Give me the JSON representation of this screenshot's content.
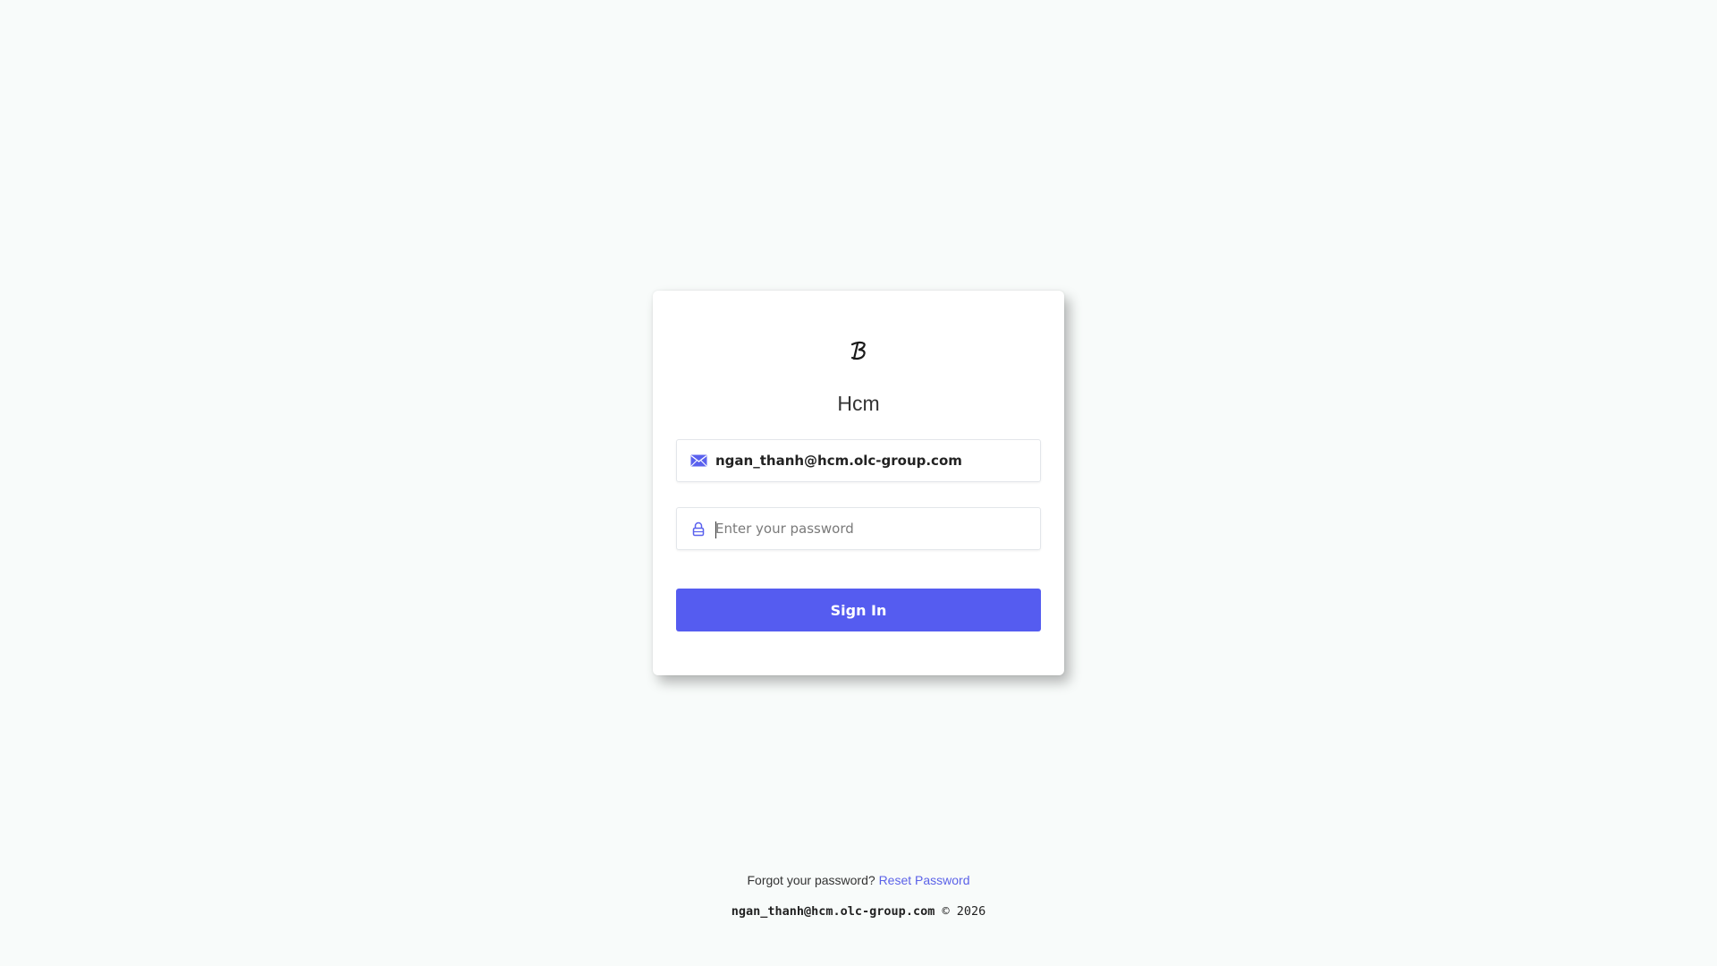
{
  "brand": {
    "logo_icon": "brand-script-b-icon",
    "title": "Hcm"
  },
  "login_form": {
    "email_icon": "envelope-icon",
    "email_value": "ngan_thanh@hcm.olc-group.com",
    "password_icon": "lock-icon",
    "password_value": "",
    "password_placeholder": "Enter your password",
    "sign_in_label": "Sign In"
  },
  "footer": {
    "forgot_text": "Forgot your password?",
    "reset_link_label": "Reset Password",
    "copyright_email": "ngan_thanh@hcm.olc-group.com",
    "copyright_suffix": "© 2026"
  },
  "colors": {
    "accent": "#555cf0",
    "link": "#5b62e8",
    "background": "#f8fbfa"
  }
}
